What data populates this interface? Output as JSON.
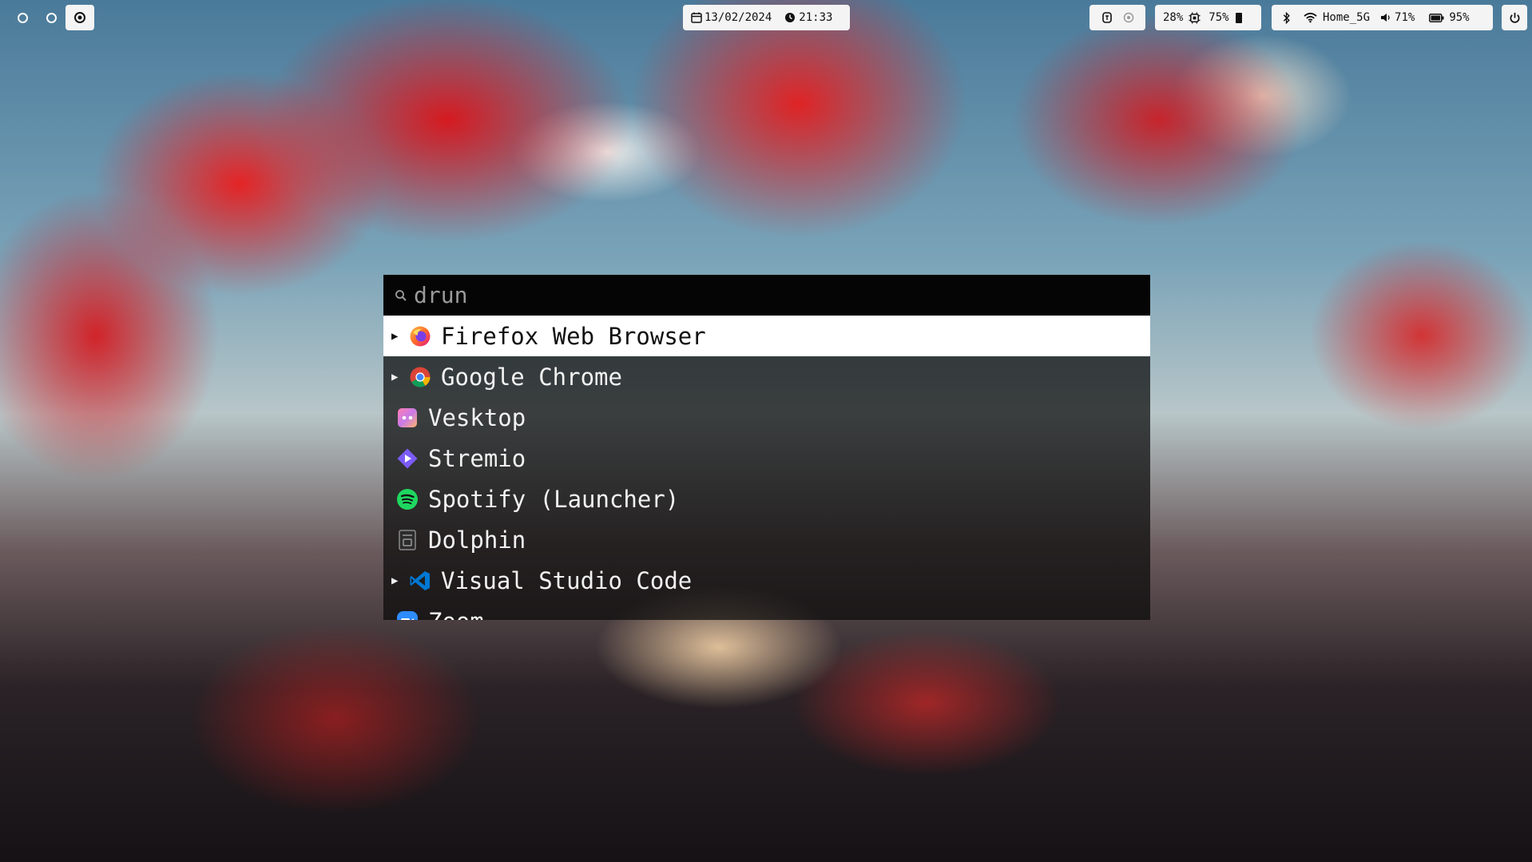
{
  "topbar": {
    "workspaces": [
      "1",
      "2",
      "3"
    ],
    "date": "13/02/2024",
    "time": "21:33",
    "brightness": "28%",
    "cpu": "75%",
    "wifi_ssid": "Home_5G",
    "volume": "71%",
    "battery": "95%"
  },
  "launcher": {
    "search_value": "drun",
    "apps": [
      {
        "label": "Firefox Web Browser",
        "has_submenu": true,
        "selected": true,
        "icon": "firefox-icon"
      },
      {
        "label": "Google Chrome",
        "has_submenu": true,
        "selected": false,
        "icon": "chrome-icon"
      },
      {
        "label": "Vesktop",
        "has_submenu": false,
        "selected": false,
        "icon": "vesktop-icon"
      },
      {
        "label": "Stremio",
        "has_submenu": false,
        "selected": false,
        "icon": "stremio-icon"
      },
      {
        "label": "Spotify (Launcher)",
        "has_submenu": false,
        "selected": false,
        "icon": "spotify-icon"
      },
      {
        "label": "Dolphin",
        "has_submenu": false,
        "selected": false,
        "icon": "dolphin-icon"
      },
      {
        "label": "Visual Studio Code",
        "has_submenu": true,
        "selected": false,
        "icon": "vscode-icon"
      },
      {
        "label": "Zoom",
        "has_submenu": false,
        "selected": false,
        "icon": "zoom-icon"
      }
    ]
  },
  "colors": {
    "bar_bg": "#f4f4f4",
    "launcher_bg": "#0a0a0a",
    "selected_bg": "#ffffff"
  }
}
